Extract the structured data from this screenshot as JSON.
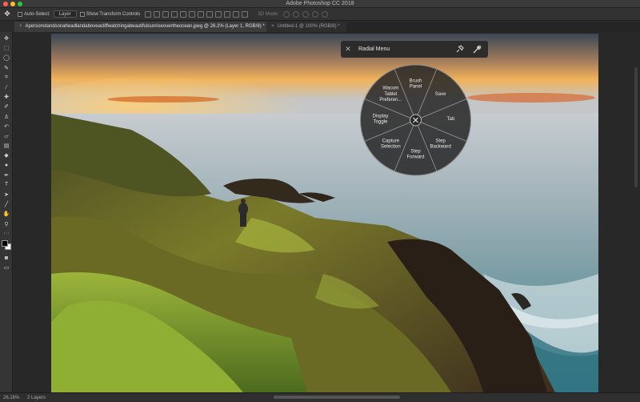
{
  "app": {
    "title": "Adobe Photoshop CC 2018"
  },
  "options": {
    "auto_select_label": "Auto-Select:",
    "auto_select_value": "Layer",
    "transform_label": "Show Transform Controls",
    "mode_3d": "3D Mode:"
  },
  "tabs": [
    {
      "label": "Apersonstandsonaheadlandaboveacliffwatchingabeautifulsunriseovertheocean.jpeg @ 26.2% (Layer 1, RGB/8) *"
    },
    {
      "label": "Untitled-1 @ 100% (RGB/8) *"
    }
  ],
  "radial_menu": {
    "title": "Radial Menu",
    "items": [
      {
        "label": "Brush Panel"
      },
      {
        "label": "Save"
      },
      {
        "label": "Tab"
      },
      {
        "label": "Step Backward"
      },
      {
        "label": "Step Forward"
      },
      {
        "label": "Capture Selection"
      },
      {
        "label": "Display Toggle"
      },
      {
        "label": "Wacom Tablet Preferen..."
      }
    ]
  },
  "status": {
    "zoom": "26.16%",
    "doc_info": "2 Layers"
  },
  "colors": {
    "accent": "#ff5f57",
    "sky_top": "#3a4756",
    "sun": "#f2a648",
    "grass": "#7b9b2b",
    "sea": "#4c8a94"
  }
}
